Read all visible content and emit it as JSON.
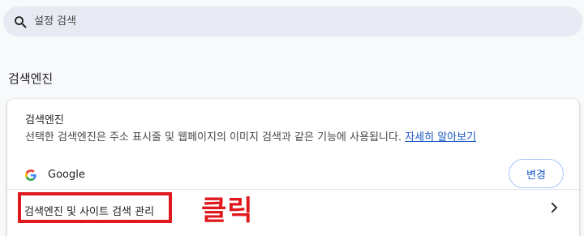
{
  "search": {
    "placeholder": "설정 검색"
  },
  "section": {
    "title": "검색엔진"
  },
  "card": {
    "heading": "검색엔진",
    "description": "선택한 검색엔진은 주소 표시줄 및 웹페이지의 이미지 검색과 같은 기능에 사용됩니다.",
    "learn_more_label": "자세히 알아보기",
    "engine": {
      "name": "Google",
      "icon": "google-g-logo"
    },
    "change_button_label": "변경",
    "manage_label": "검색엔진 및 사이트 검색 관리"
  },
  "annotation": {
    "text": "클릭"
  },
  "colors": {
    "accent": "#1a57c4",
    "annotation_red": "#e0191f"
  }
}
